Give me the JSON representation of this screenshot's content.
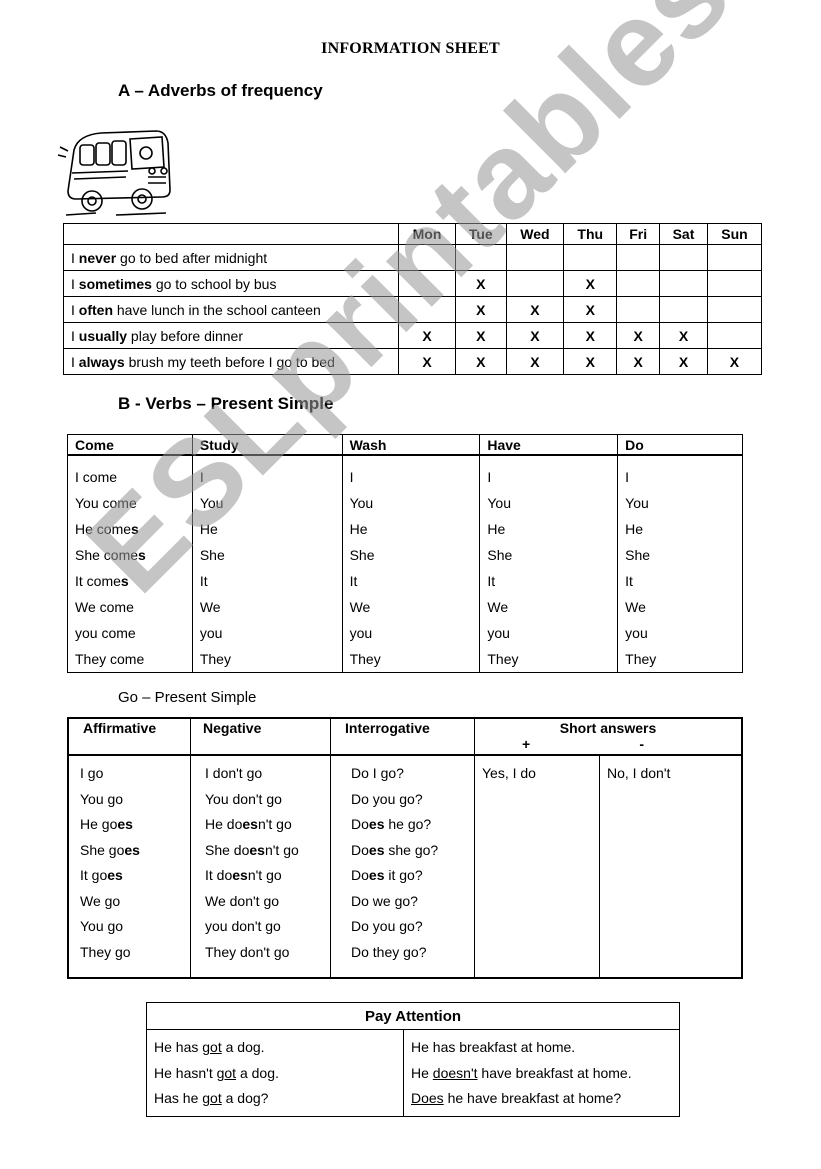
{
  "title": "INFORMATION SHEET",
  "section_a": {
    "heading": "A – Adverbs of frequency",
    "image": "school-bus-illustration",
    "days": [
      "Mon",
      "Tue",
      "Wed",
      "Thu",
      "Fri",
      "Sat",
      "Sun"
    ],
    "rows": [
      {
        "pre": "I ",
        "adverb": "never",
        "post": " go to bed after midnight",
        "marks": [
          "",
          "",
          "",
          "",
          "",
          "",
          ""
        ]
      },
      {
        "pre": "I ",
        "adverb": "sometimes",
        "post": " go to school by bus",
        "marks": [
          "",
          "X",
          "",
          "X",
          "",
          "",
          ""
        ]
      },
      {
        "pre": "I ",
        "adverb": "often",
        "post": " have lunch in the school canteen",
        "marks": [
          "",
          "X",
          "X",
          "X",
          "",
          "",
          ""
        ]
      },
      {
        "pre": "I ",
        "adverb": "usually",
        "post": " play before dinner",
        "marks": [
          "X",
          "X",
          "X",
          "X",
          "X",
          "X",
          ""
        ]
      },
      {
        "pre": "I ",
        "adverb": "always",
        "post": " brush my teeth before I go to bed",
        "marks": [
          "X",
          "X",
          "X",
          "X",
          "X",
          "X",
          "X"
        ]
      }
    ]
  },
  "section_b": {
    "heading": "B - Verbs – Present Simple",
    "columns": [
      {
        "verb": "Come",
        "forms": [
          [
            "I come",
            ""
          ],
          [
            "You come",
            ""
          ],
          [
            "He come",
            "s"
          ],
          [
            "She come",
            "s"
          ],
          [
            "It come",
            "s"
          ],
          [
            "We come",
            ""
          ],
          [
            "you come",
            ""
          ],
          [
            "They come",
            ""
          ]
        ]
      },
      {
        "verb": "Study",
        "forms": [
          [
            "I",
            ""
          ],
          [
            "You",
            ""
          ],
          [
            "He",
            ""
          ],
          [
            "She",
            ""
          ],
          [
            "It",
            ""
          ],
          [
            "We",
            ""
          ],
          [
            "you",
            ""
          ],
          [
            "They",
            ""
          ]
        ]
      },
      {
        "verb": "Wash",
        "forms": [
          [
            "I",
            ""
          ],
          [
            "You",
            ""
          ],
          [
            "He",
            ""
          ],
          [
            "She",
            ""
          ],
          [
            "It",
            ""
          ],
          [
            "We",
            ""
          ],
          [
            "you",
            ""
          ],
          [
            "They",
            ""
          ]
        ]
      },
      {
        "verb": "Have",
        "forms": [
          [
            "I",
            ""
          ],
          [
            "You",
            ""
          ],
          [
            "He",
            ""
          ],
          [
            "She",
            ""
          ],
          [
            "It",
            ""
          ],
          [
            "We",
            ""
          ],
          [
            "you",
            ""
          ],
          [
            "They",
            ""
          ]
        ]
      },
      {
        "verb": "Do",
        "forms": [
          [
            "I",
            ""
          ],
          [
            "You",
            ""
          ],
          [
            "He",
            ""
          ],
          [
            "She",
            ""
          ],
          [
            "It",
            ""
          ],
          [
            "We",
            ""
          ],
          [
            "you",
            ""
          ],
          [
            "They",
            ""
          ]
        ]
      }
    ]
  },
  "go_section": {
    "heading": "Go – Present Simple",
    "headers": {
      "affirmative": "Affirmative",
      "negative": "Negative",
      "interrogative": "Interrogative",
      "short_answers": "Short answers",
      "plus": "+",
      "minus": "-"
    },
    "affirmative": [
      [
        "I go",
        "",
        ""
      ],
      [
        "You go",
        "",
        ""
      ],
      [
        "He go",
        "es",
        ""
      ],
      [
        "She go",
        "es",
        ""
      ],
      [
        "It go",
        "es",
        ""
      ],
      [
        "We go",
        "",
        ""
      ],
      [
        "You go",
        "",
        ""
      ],
      [
        "They go",
        "",
        ""
      ]
    ],
    "negative": [
      [
        "I don't go",
        "",
        ""
      ],
      [
        "You don't go",
        "",
        ""
      ],
      [
        "He do",
        "es",
        "n't go"
      ],
      [
        "She do",
        "es",
        "n't go"
      ],
      [
        "It do",
        "es",
        "n't go"
      ],
      [
        "We don't go",
        "",
        ""
      ],
      [
        "you don't go",
        "",
        ""
      ],
      [
        "They don't go",
        "",
        ""
      ]
    ],
    "interrogative": [
      [
        "Do I go?",
        "",
        ""
      ],
      [
        "Do you go?",
        "",
        ""
      ],
      [
        "Do",
        "es",
        " he go?"
      ],
      [
        "Do",
        "es",
        " she go?"
      ],
      [
        "Do",
        "es",
        " it go?"
      ],
      [
        "Do we go?",
        "",
        ""
      ],
      [
        "Do you go?",
        "",
        ""
      ],
      [
        "Do they go?",
        "",
        ""
      ]
    ],
    "short_positive": "Yes, I do",
    "short_negative": "No, I don't"
  },
  "pay_attention": {
    "heading": "Pay Attention",
    "left": [
      {
        "pre": "He has ",
        "u": "got",
        "post": " a dog."
      },
      {
        "pre": "He hasn't ",
        "u": "got",
        "post": " a dog."
      },
      {
        "pre": "Has he ",
        "u": "got",
        "post": " a dog?"
      }
    ],
    "right": [
      {
        "pre": "He has breakfast at home.",
        "u": "",
        "post": ""
      },
      {
        "pre": "He ",
        "u": "doesn't",
        "post": " have breakfast at home."
      },
      {
        "pre": "",
        "u": "Does",
        "post": " he have breakfast at home?"
      }
    ]
  },
  "watermark": "ESLprintables.com"
}
